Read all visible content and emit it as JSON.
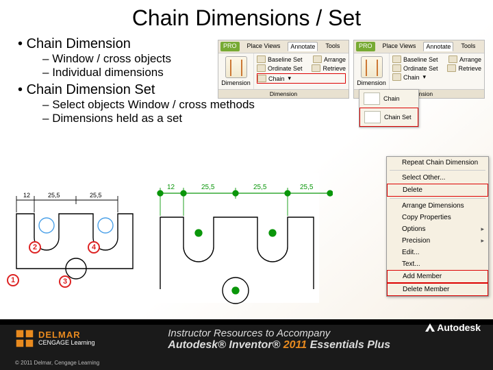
{
  "title": "Chain Dimensions / Set",
  "sections": [
    {
      "heading": "Chain Dimension",
      "subs": [
        "Window / cross objects",
        "Individual dimensions"
      ]
    },
    {
      "heading": "Chain Dimension Set",
      "subs": [
        "Select objects Window / cross methods",
        "Dimensions held as a set"
      ]
    }
  ],
  "ribbon": {
    "tabs": [
      "Place Views",
      "Annotate",
      "Tools"
    ],
    "file": "PRO",
    "big_label": "Dimension",
    "stack": [
      {
        "label": "Baseline Set",
        "r": "Arrange"
      },
      {
        "label": "Ordinate Set",
        "r": "Retrieve"
      },
      {
        "label": "Chain",
        "highlight_a": true
      }
    ],
    "footer": "Dimension"
  },
  "chain_dd": {
    "items": [
      "Chain",
      "Chain Set"
    ]
  },
  "diagram": {
    "dims": [
      "12",
      "25.5",
      "25.5"
    ],
    "balloons": [
      "1",
      "2",
      "3",
      "4"
    ]
  },
  "diagram2": {
    "dims": [
      "12",
      "25.5",
      "25.5",
      "25.5"
    ]
  },
  "ctxmenu": {
    "items": [
      {
        "label": "Repeat Chain Dimension"
      },
      {
        "sep": true
      },
      {
        "label": "Select Other..."
      },
      {
        "label": "Delete",
        "boxed": true
      },
      {
        "sep": true
      },
      {
        "label": "Arrange Dimensions"
      },
      {
        "label": "Copy Properties"
      },
      {
        "label": "Options",
        "arrow": true
      },
      {
        "label": "Precision",
        "arrow": true
      },
      {
        "label": "Edit..."
      },
      {
        "label": "Text..."
      },
      {
        "label": "Add Member",
        "boxed": true
      },
      {
        "label": "Delete Member",
        "boxed": true
      }
    ]
  },
  "footer": {
    "brand": "DELMAR",
    "brand2": "CENGAGE Learning",
    "copy": "© 2011 Delmar, Cengage Learning",
    "r1": "Instructor Resources to Accompany",
    "r2a": "Autodesk® Inventor®",
    "r2b": " 2011 ",
    "r2c": "Essentials Plus",
    "adsk": "Autodesk"
  }
}
